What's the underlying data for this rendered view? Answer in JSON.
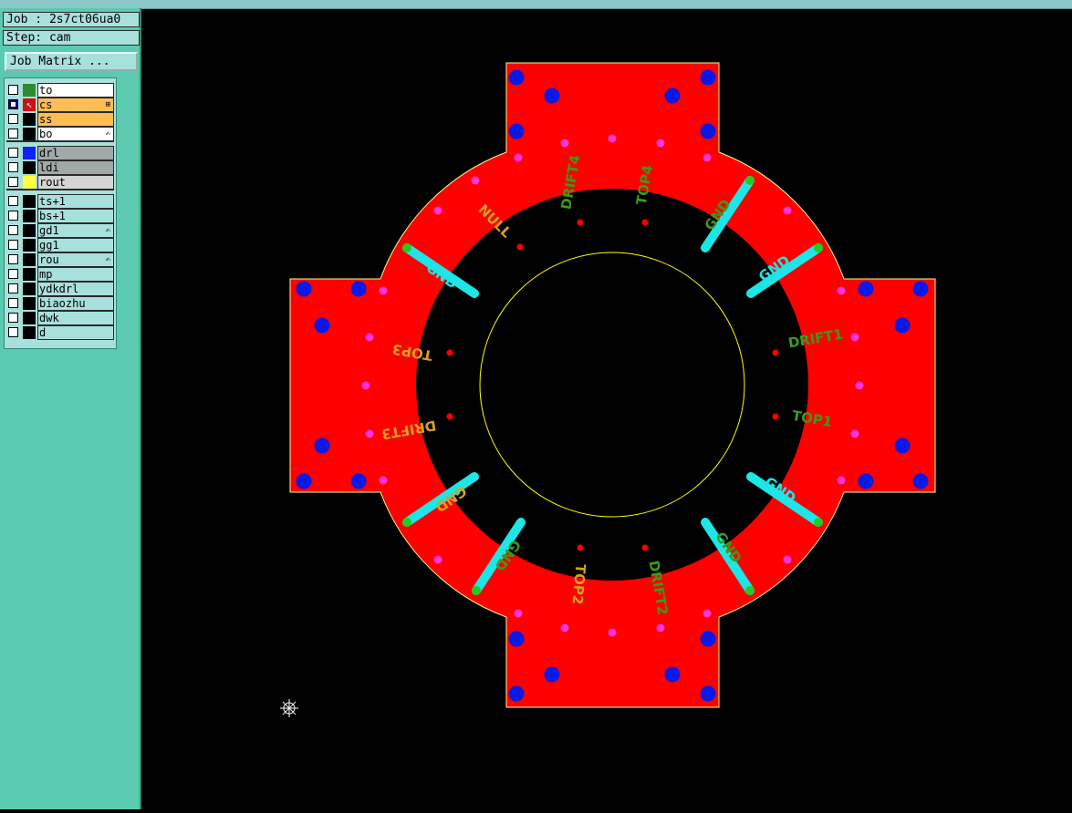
{
  "job": {
    "label": "Job : 2s7ct06ua0"
  },
  "step": {
    "label": "Step: cam"
  },
  "job_matrix": {
    "label": "Job Matrix ..."
  },
  "layers": [
    {
      "name": "to",
      "color": "#2e8b2e",
      "bg": "#ffffff",
      "checked": false
    },
    {
      "name": "cs",
      "color": "#d01010",
      "bg": "#ffbe55",
      "checked": true,
      "marker": "↖",
      "flag": "⊞"
    },
    {
      "name": "ss",
      "color": "#000000",
      "bg": "#ffbe55",
      "checked": false
    },
    {
      "name": "bo",
      "color": "#000000",
      "bg": "#ffffff",
      "checked": false,
      "flag": "✍"
    },
    {
      "name": "drl",
      "color": "#1020ff",
      "bg": "#a0a8a8",
      "checked": false
    },
    {
      "name": "ldi",
      "color": "#000000",
      "bg": "#a0a8a8",
      "checked": false
    },
    {
      "name": "rout",
      "color": "#ffff40",
      "bg": "#d4d4d4",
      "checked": false
    },
    {
      "name": "ts+1",
      "color": "#000000",
      "bg": "#a8e0dc",
      "checked": false
    },
    {
      "name": "bs+1",
      "color": "#000000",
      "bg": "#a8e0dc",
      "checked": false
    },
    {
      "name": "gd1",
      "color": "#000000",
      "bg": "#a8e0dc",
      "checked": false,
      "flag": "✍"
    },
    {
      "name": "gg1",
      "color": "#000000",
      "bg": "#a8e0dc",
      "checked": false
    },
    {
      "name": "rou",
      "color": "#000000",
      "bg": "#a8e0dc",
      "checked": false,
      "flag": "✍"
    },
    {
      "name": "mp",
      "color": "#000000",
      "bg": "#a8e0dc",
      "checked": false
    },
    {
      "name": "ydkdrl",
      "color": "#000000",
      "bg": "#a8e0dc",
      "checked": false
    },
    {
      "name": "biaozhu",
      "color": "#000000",
      "bg": "#a8e0dc",
      "checked": false
    },
    {
      "name": "dwk",
      "color": "#000000",
      "bg": "#a8e0dc",
      "checked": false
    },
    {
      "name": "d",
      "color": "#000000",
      "bg": "#a8e0dc",
      "checked": false
    }
  ],
  "board": {
    "labels": {
      "null": "NULL",
      "drift4": "DRIFT4",
      "top4": "TOP4",
      "drift1": "DRIFT1",
      "top1": "TOP1",
      "top3": "TOP3",
      "drift3": "DRIFT3",
      "top2": "TOP2",
      "drift2": "DRIFT2",
      "gnd": "GND"
    },
    "colors": {
      "copper": "#ff0000",
      "outline": "#ffff80",
      "drill": "#0a18e6",
      "via": "#ff33dd",
      "pad": "#ff0000",
      "trace": "#1ee6e6",
      "trace_end": "#22cc22",
      "label_green": "#3a9a1a",
      "label_orange": "#d8a020",
      "inner_circle": "#ffff00"
    }
  },
  "cursor": {
    "icon": "crosshair-icon"
  }
}
